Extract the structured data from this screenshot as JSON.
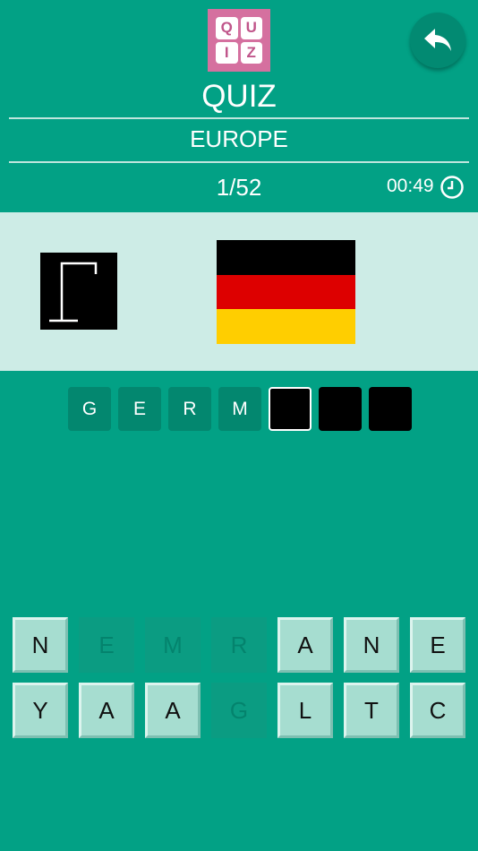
{
  "header": {
    "logo_letters": [
      "Q",
      "U",
      "I",
      "Z"
    ],
    "title": "QUIZ",
    "category": "EUROPE",
    "progress": "1/52",
    "timer": "00:49"
  },
  "flag": {
    "country_colors": [
      "#000000",
      "#dd0000",
      "#ffce00"
    ]
  },
  "answer": {
    "slots": [
      {
        "letter": "G",
        "state": "filled"
      },
      {
        "letter": "E",
        "state": "filled"
      },
      {
        "letter": "R",
        "state": "filled"
      },
      {
        "letter": "M",
        "state": "filled"
      },
      {
        "letter": "",
        "state": "active"
      },
      {
        "letter": "",
        "state": "empty"
      },
      {
        "letter": "",
        "state": "empty"
      }
    ]
  },
  "keyboard": {
    "rows": [
      [
        {
          "letter": "N",
          "used": false
        },
        {
          "letter": "E",
          "used": true
        },
        {
          "letter": "M",
          "used": true
        },
        {
          "letter": "R",
          "used": true
        },
        {
          "letter": "A",
          "used": false
        },
        {
          "letter": "N",
          "used": false
        },
        {
          "letter": "E",
          "used": false
        }
      ],
      [
        {
          "letter": "Y",
          "used": false
        },
        {
          "letter": "A",
          "used": false
        },
        {
          "letter": "A",
          "used": false
        },
        {
          "letter": "G",
          "used": true
        },
        {
          "letter": "L",
          "used": false
        },
        {
          "letter": "T",
          "used": false
        },
        {
          "letter": "C",
          "used": false
        }
      ]
    ]
  },
  "colors": {
    "background": "#02a185",
    "panel": "#cdece6",
    "logo": "#d5709f"
  }
}
